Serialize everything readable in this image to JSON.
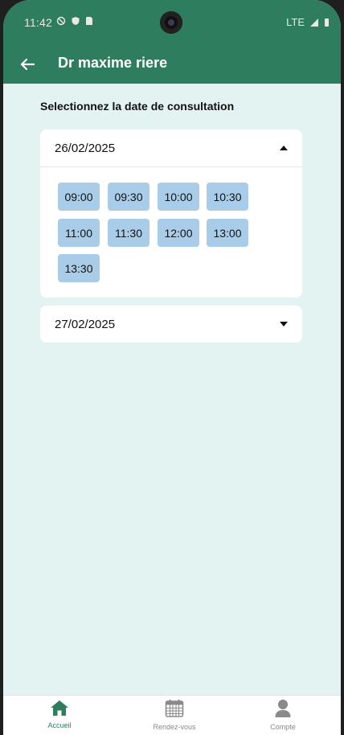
{
  "status": {
    "time": "11:42",
    "network": "LTE"
  },
  "appbar": {
    "title": "Dr maxime riere"
  },
  "main": {
    "section_title": "Selectionnez la date de consultation",
    "dates": [
      {
        "label": "26/02/2025",
        "expanded": true,
        "slots": [
          "09:00",
          "09:30",
          "10:00",
          "10:30",
          "11:00",
          "11:30",
          "12:00",
          "13:00",
          "13:30"
        ]
      },
      {
        "label": "27/02/2025",
        "expanded": false
      }
    ]
  },
  "nav": {
    "items": [
      {
        "label": "Accueil",
        "icon": "home-icon",
        "active": true
      },
      {
        "label": "Rendez-vous",
        "icon": "calendar-icon",
        "active": false
      },
      {
        "label": "Compte",
        "icon": "user-icon",
        "active": false
      }
    ]
  },
  "colors": {
    "primary": "#2e7d5f",
    "background": "#e3f3f2",
    "slot": "#a9cde8"
  }
}
